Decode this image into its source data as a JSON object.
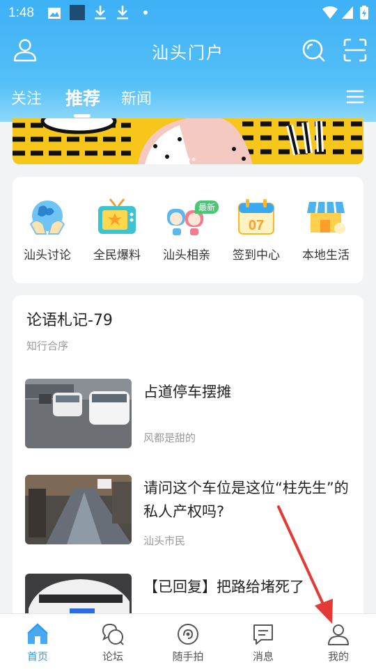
{
  "status": {
    "time": "1:48"
  },
  "header": {
    "title": "汕头门户"
  },
  "tabs": [
    {
      "label": "关注"
    },
    {
      "label": "推荐"
    },
    {
      "label": "新闻"
    }
  ],
  "quick_links": [
    {
      "label": "汕头讨论",
      "icon": "globe-hands-icon"
    },
    {
      "label": "全民爆料",
      "icon": "tv-icon"
    },
    {
      "label": "汕头相亲",
      "icon": "couple-icon",
      "badge": "最新"
    },
    {
      "label": "签到中心",
      "icon": "calendar-icon",
      "date": "07"
    },
    {
      "label": "本地生活",
      "icon": "shop-icon"
    }
  ],
  "feed": {
    "title": "论语札记-79",
    "subtitle": "知行合序",
    "posts": [
      {
        "title": "占道停车摆摊",
        "author": "风都是甜的"
      },
      {
        "title": "请问这个车位是这位“柱先生”的私人产权吗?",
        "author": "汕头市民"
      },
      {
        "title": "【已回复】把路给堵死了",
        "author": ""
      }
    ]
  },
  "bottom_nav": [
    {
      "label": "首页",
      "active": true
    },
    {
      "label": "论坛"
    },
    {
      "label": "随手拍"
    },
    {
      "label": "消息"
    },
    {
      "label": "我的"
    }
  ],
  "colors": {
    "header": "#3db0f6",
    "accent": "#2f9bf0",
    "arrow": "#e53935"
  }
}
